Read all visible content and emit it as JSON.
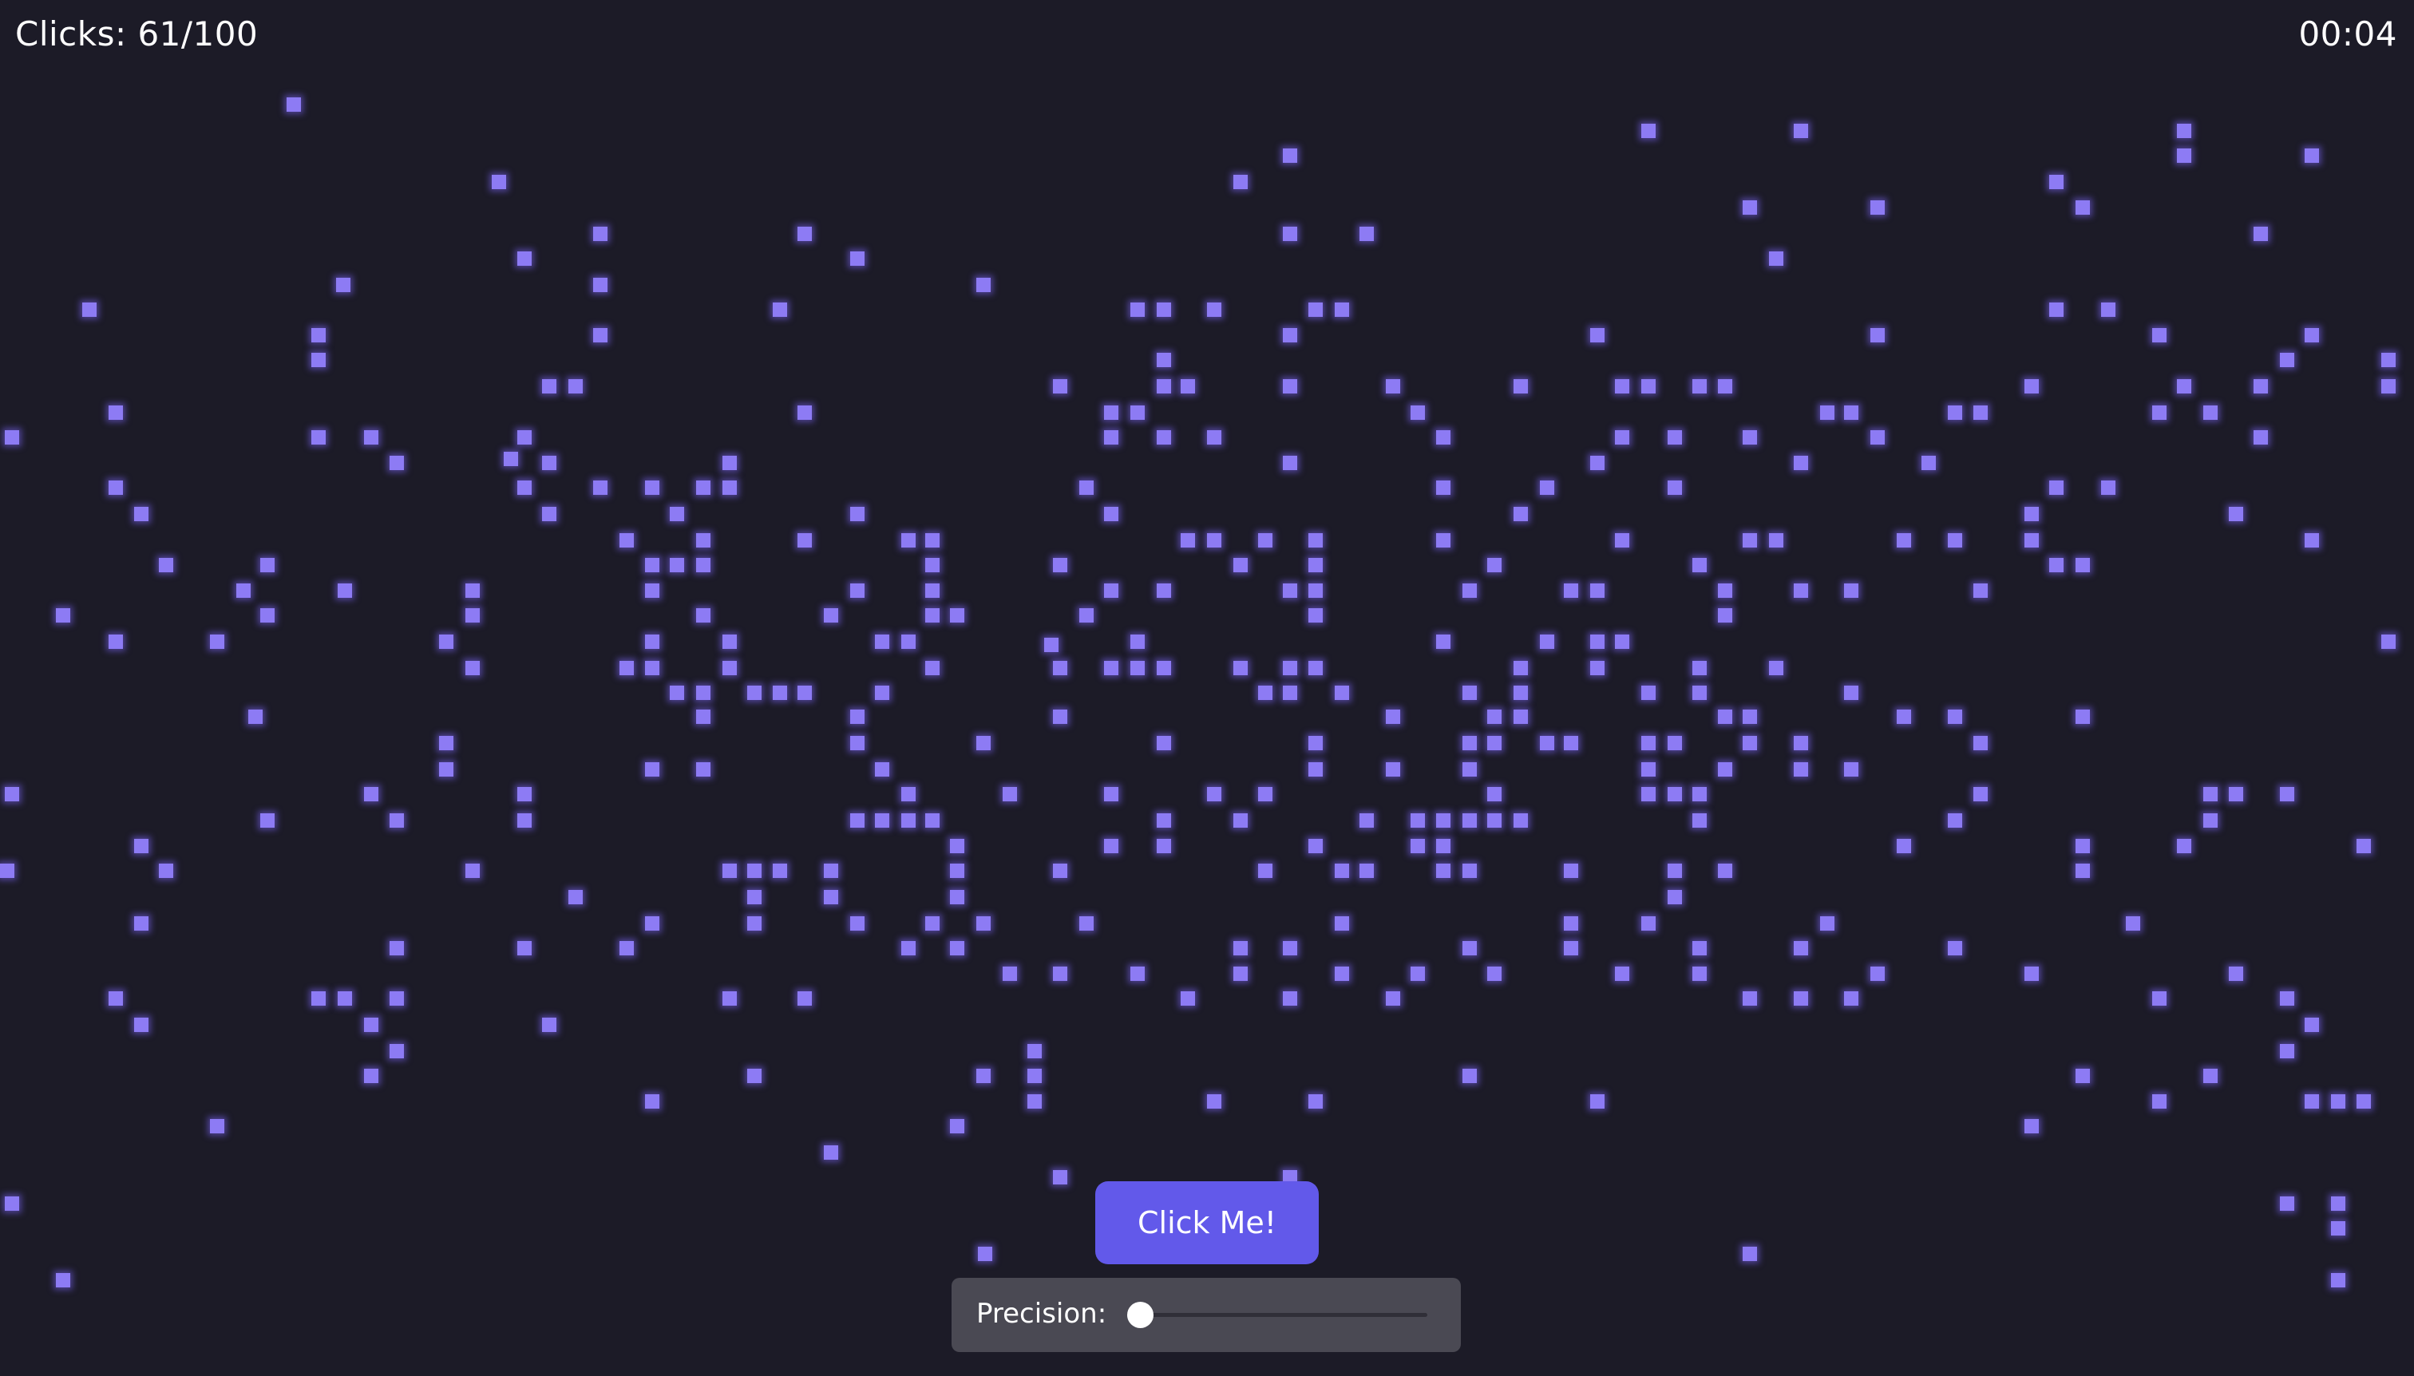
{
  "hud": {
    "clicks_label": "Clicks: 61/100",
    "timer": "00:04"
  },
  "button": {
    "label": "Click Me!"
  },
  "precision": {
    "label": "Precision:",
    "value_fraction": 0
  },
  "colors": {
    "background": "#1c1b27",
    "square": "#8d7bf4",
    "button": "#6259ea",
    "panel": "#4a4953"
  }
}
